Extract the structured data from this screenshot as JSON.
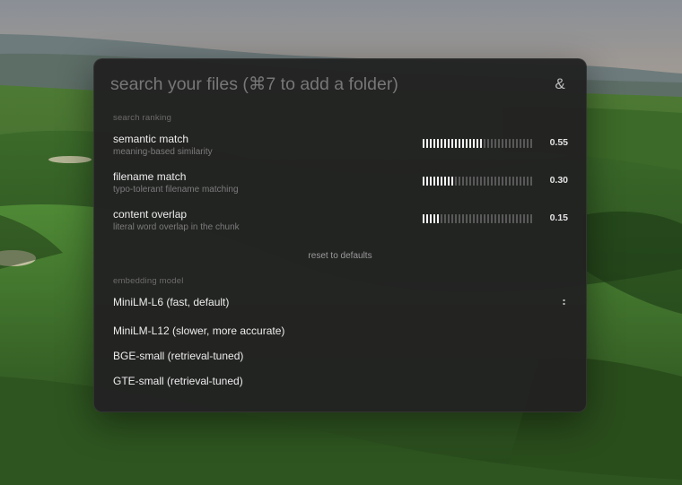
{
  "search": {
    "placeholder": "search your files (⌘7 to add a folder)",
    "value": ""
  },
  "settings_icon": {
    "glyph": "&",
    "name": "ampersand-icon"
  },
  "ranking": {
    "section_label": "search ranking",
    "sliders": [
      {
        "title": "semantic match",
        "description": "meaning-based similarity",
        "value_text": "0.55",
        "value": 0.55
      },
      {
        "title": "filename match",
        "description": "typo-tolerant filename matching",
        "value_text": "0.30",
        "value": 0.3
      },
      {
        "title": "content overlap",
        "description": "literal word overlap in the chunk",
        "value_text": "0.15",
        "value": 0.15
      }
    ],
    "reset_label": "reset to defaults"
  },
  "embedding": {
    "section_label": "embedding model",
    "selected_index": 0,
    "models": [
      {
        "label": "MiniLM-L6 (fast, default)"
      },
      {
        "label": "MiniLM-L12 (slower, more accurate)"
      },
      {
        "label": "BGE-small (retrieval-tuned)"
      },
      {
        "label": "GTE-small (retrieval-tuned)"
      }
    ]
  },
  "colors": {
    "panel_bg": "#222222",
    "slider_on": "#f3f3f3",
    "slider_off": "#595959"
  }
}
